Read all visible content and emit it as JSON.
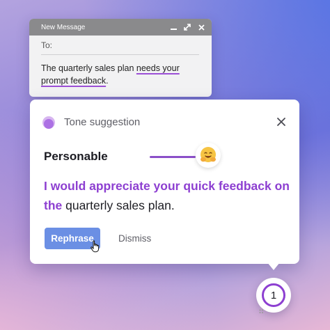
{
  "compose": {
    "title": "New Message",
    "to_label": "To:",
    "body_plain": "The quarterly sales plan ",
    "body_flag_1": "needs your",
    "body_flag_2": "prompt feedback",
    "body_end": ".",
    "icons": [
      "minimize-icon",
      "expand-icon",
      "close-icon"
    ]
  },
  "suggestion_card": {
    "title": "Tone suggestion",
    "tone": "Personable",
    "emoji": "hugging-face",
    "suggestion_highlight": "I would appreciate your quick feedback on the",
    "suggestion_rest": " quarterly sales plan.",
    "primary_action": "Rephrase",
    "secondary_action": "Dismiss"
  },
  "badge": {
    "count": "1"
  },
  "colors": {
    "accent_purple": "#8d3fd1",
    "button_blue": "#6b8fe4",
    "header_gray": "#8a8a8c"
  }
}
